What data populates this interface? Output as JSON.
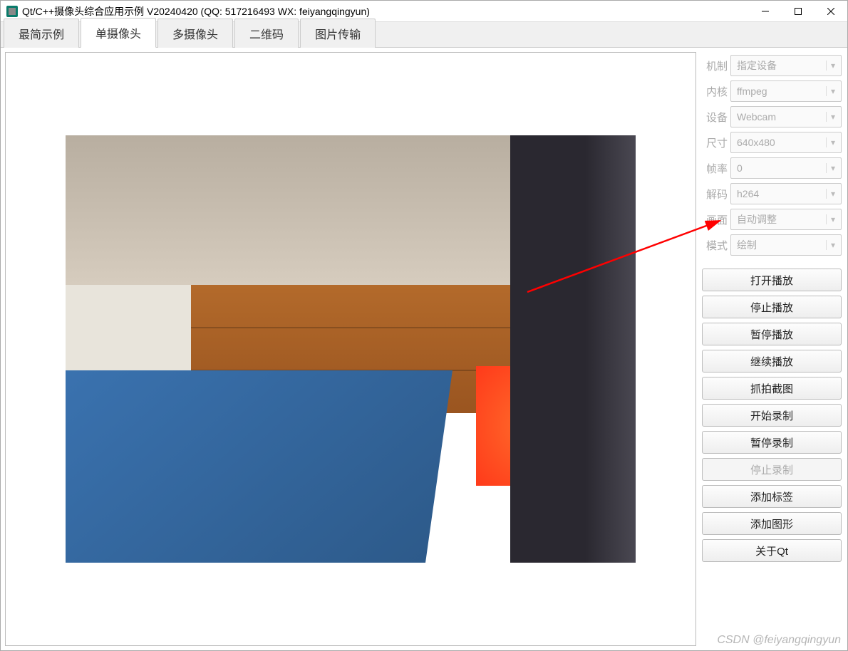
{
  "window": {
    "title": "Qt/C++摄像头综合应用示例 V20240420 (QQ: 517216493 WX: feiyangqingyun)"
  },
  "tabs": [
    {
      "label": "最简示例",
      "active": false
    },
    {
      "label": "单摄像头",
      "active": true
    },
    {
      "label": "多摄像头",
      "active": false
    },
    {
      "label": "二维码",
      "active": false
    },
    {
      "label": "图片传输",
      "active": false
    }
  ],
  "settings": [
    {
      "label": "机制",
      "value": "指定设备"
    },
    {
      "label": "内核",
      "value": "ffmpeg"
    },
    {
      "label": "设备",
      "value": "Webcam"
    },
    {
      "label": "尺寸",
      "value": "640x480"
    },
    {
      "label": "帧率",
      "value": "0"
    },
    {
      "label": "解码",
      "value": "h264"
    },
    {
      "label": "画面",
      "value": "自动调整"
    },
    {
      "label": "模式",
      "value": "绘制"
    }
  ],
  "buttons": [
    {
      "label": "打开播放",
      "disabled": false
    },
    {
      "label": "停止播放",
      "disabled": false
    },
    {
      "label": "暂停播放",
      "disabled": false
    },
    {
      "label": "继续播放",
      "disabled": false
    },
    {
      "label": "抓拍截图",
      "disabled": false
    },
    {
      "label": "开始录制",
      "disabled": false
    },
    {
      "label": "暂停录制",
      "disabled": false
    },
    {
      "label": "停止录制",
      "disabled": true
    },
    {
      "label": "添加标签",
      "disabled": false
    },
    {
      "label": "添加图形",
      "disabled": false
    },
    {
      "label": "关于Qt",
      "disabled": false
    }
  ],
  "watermark": "CSDN @feiyangqingyun"
}
